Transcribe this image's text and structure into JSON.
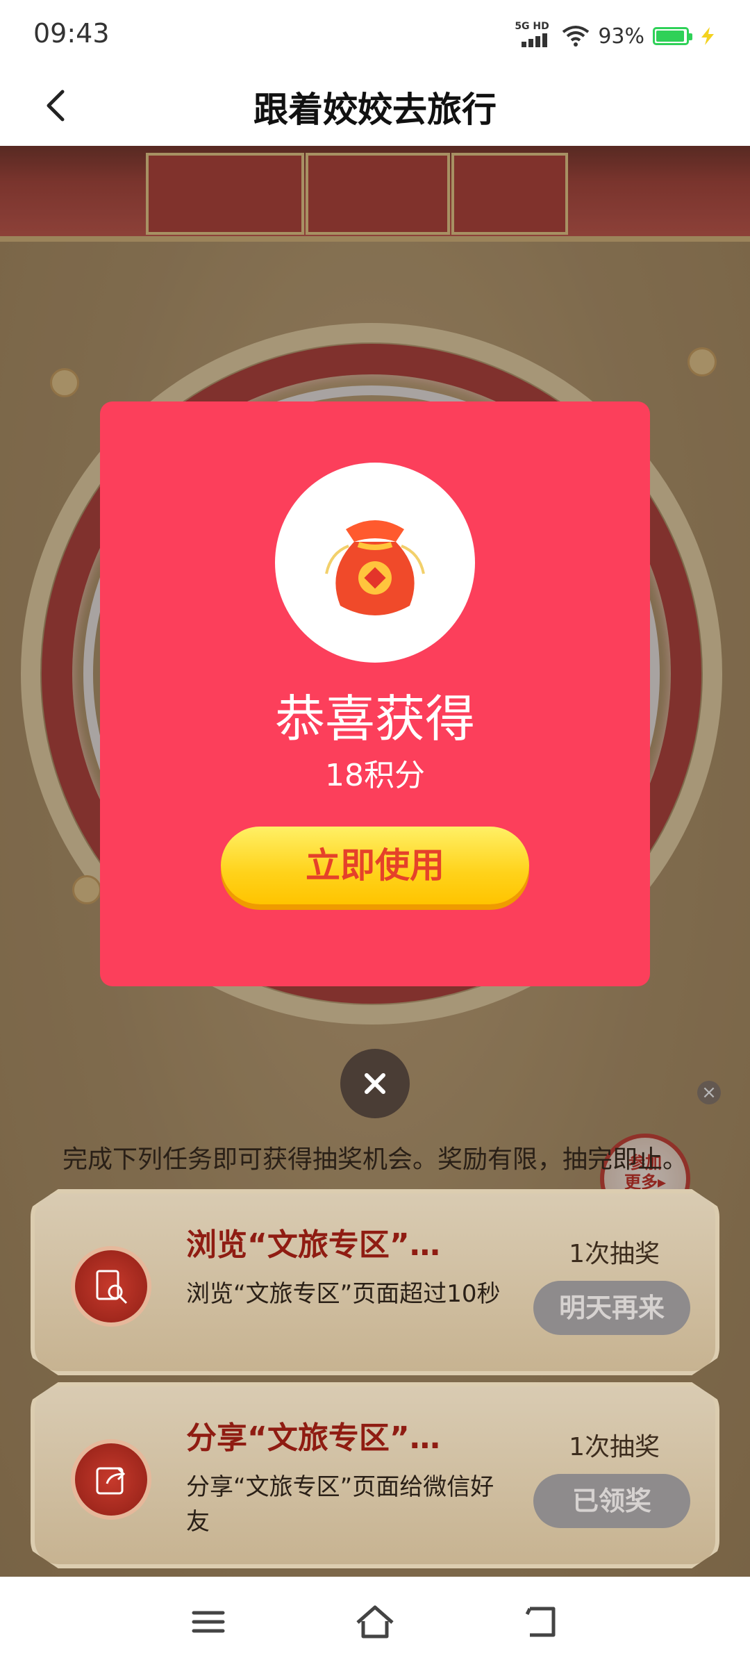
{
  "status_bar": {
    "time": "09:43",
    "network": "5G HD",
    "battery": "93%"
  },
  "header": {
    "title": "跟着姣姣去旅行"
  },
  "side": {
    "join_label": "参加\n更多▸\n活动"
  },
  "modal": {
    "title": "恭喜获得",
    "reward": "18积分",
    "use_button": "立即使用"
  },
  "tasks": {
    "intro": "完成下列任务即可获得抽奖机会。奖励有限，抽完即止。",
    "items": [
      {
        "title": "浏览“文旅专区”…",
        "desc": "浏览“文旅专区”页面超过10秒",
        "reward": "1次抽奖",
        "button": "明天再来"
      },
      {
        "title": "分享“文旅专区”…",
        "desc": "分享“文旅专区”页面给微信好友",
        "reward": "1次抽奖",
        "button": "已领奖"
      }
    ]
  },
  "colors": {
    "modal_bg": "#fc3f5b",
    "button_yellow": "#ffd21a",
    "accent_red": "#8f1c12"
  }
}
